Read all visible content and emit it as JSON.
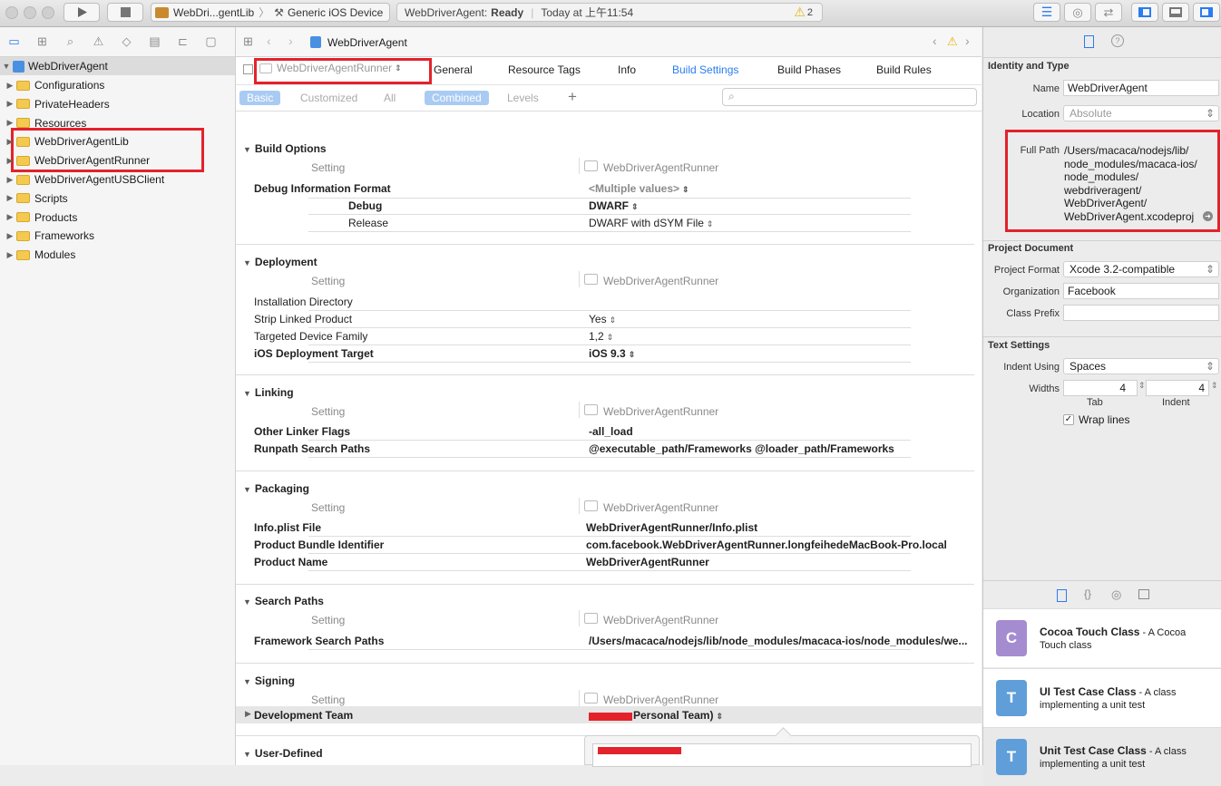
{
  "toolbar": {
    "scheme_target": "WebDri...gentLib",
    "scheme_device": "Generic iOS Device",
    "activity_project": "WebDriverAgent:",
    "activity_status": "Ready",
    "activity_time": "Today at 上午11:54",
    "warning_count": "2"
  },
  "navigator": {
    "project_name": "WebDriverAgent",
    "items": [
      {
        "label": "Configurations"
      },
      {
        "label": "PrivateHeaders"
      },
      {
        "label": "Resources"
      },
      {
        "label": "WebDriverAgentLib"
      },
      {
        "label": "WebDriverAgentRunner"
      },
      {
        "label": "WebDriverAgentUSBClient"
      },
      {
        "label": "Scripts"
      },
      {
        "label": "Products"
      },
      {
        "label": "Frameworks"
      },
      {
        "label": "Modules"
      }
    ]
  },
  "editor": {
    "breadcrumb": "WebDriverAgent",
    "target_selector": "WebDriverAgentRunner",
    "tabs": [
      "General",
      "Resource Tags",
      "Info",
      "Build Settings",
      "Build Phases",
      "Build Rules"
    ],
    "filters": [
      "Basic",
      "Customized",
      "All",
      "Combined",
      "Levels"
    ],
    "add_label": "+",
    "search_placeholder": "",
    "setting_header": "Setting",
    "target_column": "WebDriverAgentRunner",
    "sections": {
      "build_options": {
        "title": "Build Options",
        "debug_format_label": "Debug Information Format",
        "debug_format_value": "<Multiple values>",
        "debug_label": "Debug",
        "debug_value": "DWARF",
        "release_label": "Release",
        "release_value": "DWARF with dSYM File"
      },
      "deployment": {
        "title": "Deployment",
        "rows": [
          {
            "label": "Installation Directory",
            "value": ""
          },
          {
            "label": "Strip Linked Product",
            "value": "Yes"
          },
          {
            "label": "Targeted Device Family",
            "value": "1,2"
          },
          {
            "label": "iOS Deployment Target",
            "value": "iOS 9.3"
          }
        ]
      },
      "linking": {
        "title": "Linking",
        "rows": [
          {
            "label": "Other Linker Flags",
            "value": "-all_load"
          },
          {
            "label": "Runpath Search Paths",
            "value": "@executable_path/Frameworks @loader_path/Frameworks"
          }
        ]
      },
      "packaging": {
        "title": "Packaging",
        "rows": [
          {
            "label": "Info.plist File",
            "value": "WebDriverAgentRunner/Info.plist"
          },
          {
            "label": "Product Bundle Identifier",
            "value": "com.facebook.WebDriverAgentRunner.longfeihedeMacBook-Pro.local"
          },
          {
            "label": "Product Name",
            "value": "WebDriverAgentRunner"
          }
        ]
      },
      "search_paths": {
        "title": "Search Paths",
        "rows": [
          {
            "label": "Framework Search Paths",
            "value": "/Users/macaca/nodejs/lib/node_modules/macaca-ios/node_modules/we..."
          }
        ]
      },
      "signing": {
        "title": "Signing",
        "dev_team_label": "Development Team",
        "dev_team_value": "Personal Team)"
      },
      "user_defined": {
        "title": "User-Defined"
      }
    }
  },
  "inspector": {
    "identity_title": "Identity and Type",
    "name_label": "Name",
    "name_value": "WebDriverAgent",
    "location_label": "Location",
    "location_value": "Absolute",
    "full_path_label": "Full Path",
    "full_path_lines": [
      "/Users/macaca/nodejs/lib/",
      "node_modules/macaca-ios/",
      "node_modules/",
      "webdriveragent/",
      "WebDriverAgent/",
      "WebDriverAgent.xcodeproj"
    ],
    "project_doc_title": "Project Document",
    "project_format_label": "Project Format",
    "project_format_value": "Xcode 3.2-compatible",
    "organization_label": "Organization",
    "organization_value": "Facebook",
    "class_prefix_label": "Class Prefix",
    "class_prefix_value": "",
    "text_settings_title": "Text Settings",
    "indent_using_label": "Indent Using",
    "indent_using_value": "Spaces",
    "widths_label": "Widths",
    "tab_value": "4",
    "indent_value": "4",
    "tab_label": "Tab",
    "indent_label": "Indent",
    "wrap_label": "Wrap lines",
    "library": [
      {
        "icon": "C",
        "title": "Cocoa Touch Class",
        "desc1": " - A Cocoa",
        "desc2": "Touch class"
      },
      {
        "icon": "T",
        "title": "UI Test Case Class",
        "desc1": " - A class",
        "desc2": "implementing a unit test"
      },
      {
        "icon": "T",
        "title": "Unit Test Case Class",
        "desc1": " - A class",
        "desc2": "implementing a unit test"
      }
    ]
  },
  "colors": {
    "accent": "#2a7cf0",
    "highlight": "#e3222b",
    "folder": "#f4c94f"
  }
}
